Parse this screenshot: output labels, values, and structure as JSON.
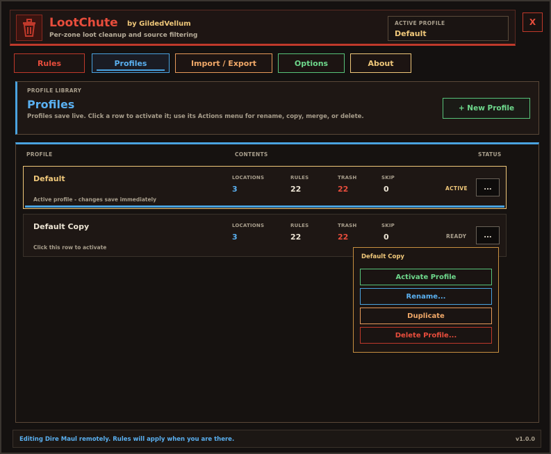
{
  "header": {
    "title": "LootChute",
    "author": "by GildedVellum",
    "tagline": "Per-zone loot cleanup and source filtering",
    "logo_icon": "trash-can-icon",
    "active_profile_label": "ACTIVE PROFILE",
    "active_profile_value": "Default",
    "close_label": "X"
  },
  "tabs": [
    {
      "label": "Rules"
    },
    {
      "label": "Profiles"
    },
    {
      "label": "Import / Export"
    },
    {
      "label": "Options"
    },
    {
      "label": "About"
    }
  ],
  "library": {
    "kicker": "PROFILE LIBRARY",
    "heading": "Profiles",
    "description": "Profiles save live. Click a row to activate it; use its Actions menu for rename, copy, merge, or delete.",
    "new_button": "+ New Profile"
  },
  "list": {
    "columns": {
      "profile": "PROFILE",
      "contents": "CONTENTS",
      "status": "STATUS"
    },
    "stat_labels": {
      "locations": "LOCATIONS",
      "rules": "RULES",
      "trash": "TRASH",
      "skip": "SKIP"
    },
    "rows": [
      {
        "name": "Default",
        "subtitle": "Active profile - changes save immediately",
        "locations": "3",
        "rules": "22",
        "trash": "22",
        "skip": "0",
        "status": "ACTIVE",
        "actions": "..."
      },
      {
        "name": "Default Copy",
        "subtitle": "Click this row to activate",
        "locations": "3",
        "rules": "22",
        "trash": "22",
        "skip": "0",
        "status": "READY",
        "actions": "..."
      }
    ]
  },
  "menu": {
    "title": "Default Copy",
    "items": [
      {
        "label": "Activate Profile"
      },
      {
        "label": "Rename..."
      },
      {
        "label": "Duplicate"
      },
      {
        "label": "Delete Profile..."
      }
    ]
  },
  "footer": {
    "message": "Editing Dire Maul remotely. Rules will apply when you are there.",
    "version": "v1.0.0"
  },
  "colors": {
    "accent_red": "#e84d3c",
    "accent_blue": "#4aa3e0",
    "accent_gold": "#f0c87a",
    "accent_green": "#58c47a",
    "accent_orange": "#e89a5a"
  }
}
